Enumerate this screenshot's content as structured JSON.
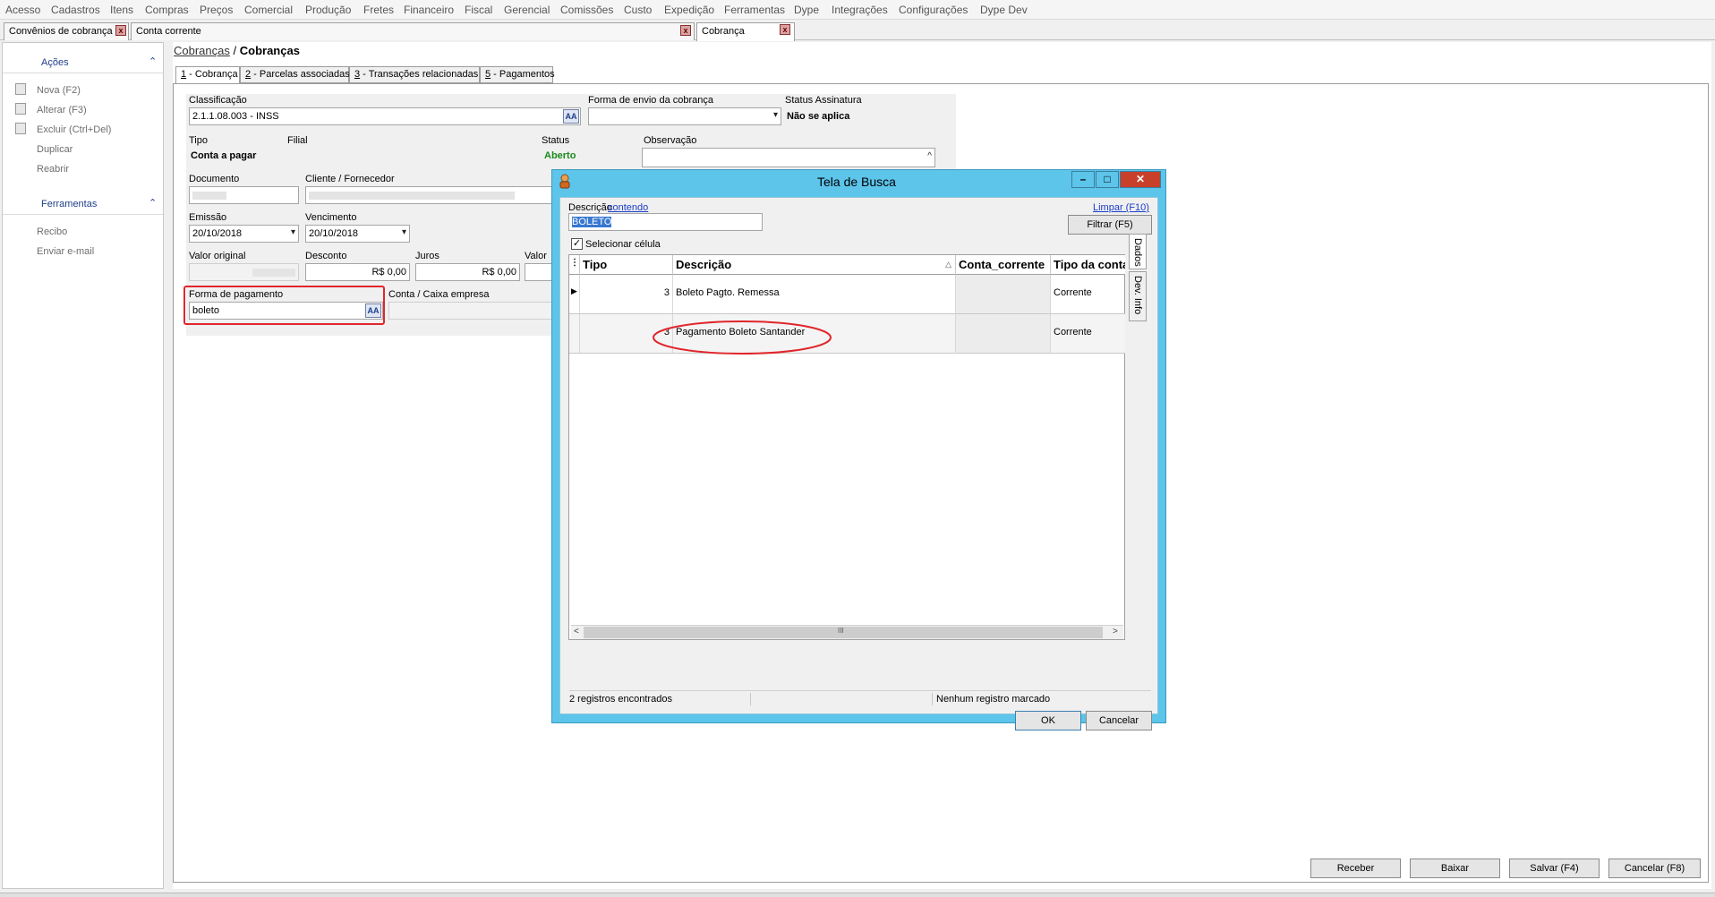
{
  "menu": [
    "Acesso",
    "Cadastros",
    "Itens",
    "Compras",
    "Preços",
    "Comercial",
    "Produção",
    "Fretes",
    "Financeiro",
    "Fiscal",
    "Gerencial",
    "Comissões",
    "Custo",
    "Expedição",
    "Ferramentas",
    "Dype",
    "Integrações",
    "Configurações",
    "Dype Dev"
  ],
  "doc_tabs": [
    {
      "label": "Convênios de cobrança"
    },
    {
      "label": "Conta corrente"
    },
    {
      "label": "Cobrança"
    }
  ],
  "sidebar": {
    "acoes_title": "Ações",
    "acoes_items": [
      "Nova (F2)",
      "Alterar (F3)",
      "Excluir (Ctrl+Del)",
      "Duplicar",
      "Reabrir"
    ],
    "ferramentas_title": "Ferramentas",
    "ferramentas_items": [
      "Recibo",
      "Enviar e-mail"
    ],
    "collapse_glyph": "⌃"
  },
  "breadcrumb": {
    "parent": "Cobranças",
    "sep": "/",
    "current": "Cobranças"
  },
  "form_tabs": [
    {
      "key": "1",
      "label": " - Cobrança"
    },
    {
      "key": "2",
      "label": " - Parcelas associadas"
    },
    {
      "key": "3",
      "label": " - Transações relacionadas"
    },
    {
      "key": "5",
      "label": " - Pagamentos"
    }
  ],
  "form": {
    "classificacao_label": "Classificação",
    "classificacao_value": "2.1.1.08.003 - INSS",
    "forma_envio_label": "Forma de envio da cobrança",
    "status_assinatura_label": "Status Assinatura",
    "status_assinatura_value": "Não se aplica",
    "tipo_label": "Tipo",
    "tipo_value": "Conta a pagar",
    "filial_label": "Filial",
    "status_label": "Status",
    "status_value": "Aberto",
    "observacao_label": "Observação",
    "documento_label": "Documento",
    "cliente_label": "Cliente / Fornecedor",
    "emissao_label": "Emissão",
    "emissao_value": "20/10/2018",
    "vencimento_label": "Vencimento",
    "vencimento_value": "20/10/2018",
    "valor_original_label": "Valor original",
    "desconto_label": "Desconto",
    "desconto_value": "R$ 0,00",
    "juros_label": "Juros",
    "juros_value": "R$ 0,00",
    "valor_label": "Valor",
    "forma_pagamento_label": "Forma de pagamento",
    "forma_pagamento_value": "boleto",
    "conta_caixa_label": "Conta / Caixa empresa",
    "lookup_glyph": "AA",
    "dropdown_glyph": "▾",
    "status_color": "#1a8a1a"
  },
  "footer_buttons": [
    "Receber",
    "Baixar",
    "Salvar (F4)",
    "Cancelar (F8)"
  ],
  "dialog": {
    "title": "Tela de Busca",
    "win_minimize": "–",
    "win_maximize": "□",
    "win_close": "✕",
    "descricao_label": "Descrição",
    "contendo_link": "contendo",
    "search_value": "BOLETO",
    "limpar_link": "Limpar (F10)",
    "filtrar_button": "Filtrar (F5)",
    "selecionar_label": "Selecionar célula",
    "checkbox_glyph": "✓",
    "sort_glyph": "△",
    "columns": [
      "Tipo",
      "Descrição",
      "Conta_corrente",
      "Tipo da conta"
    ],
    "rows": [
      {
        "tipo": "3",
        "descricao": "Boleto Pagto. Remessa",
        "conta_corrente": "",
        "tipo_conta": "Corrente"
      },
      {
        "tipo": "3",
        "descricao": "Pagamento Boleto Santander",
        "conta_corrente": "",
        "tipo_conta": "Corrente"
      }
    ],
    "side_tabs": [
      "Dados",
      "Dev. Info"
    ],
    "status_left": "2 registros encontrados",
    "status_right": "Nenhum registro marcado",
    "scroll_left": "<",
    "scroll_right": ">",
    "scroll_thumb": "III",
    "ok_button": "OK",
    "cancelar_button": "Cancelar",
    "accent_color": "#5dc4ea"
  }
}
